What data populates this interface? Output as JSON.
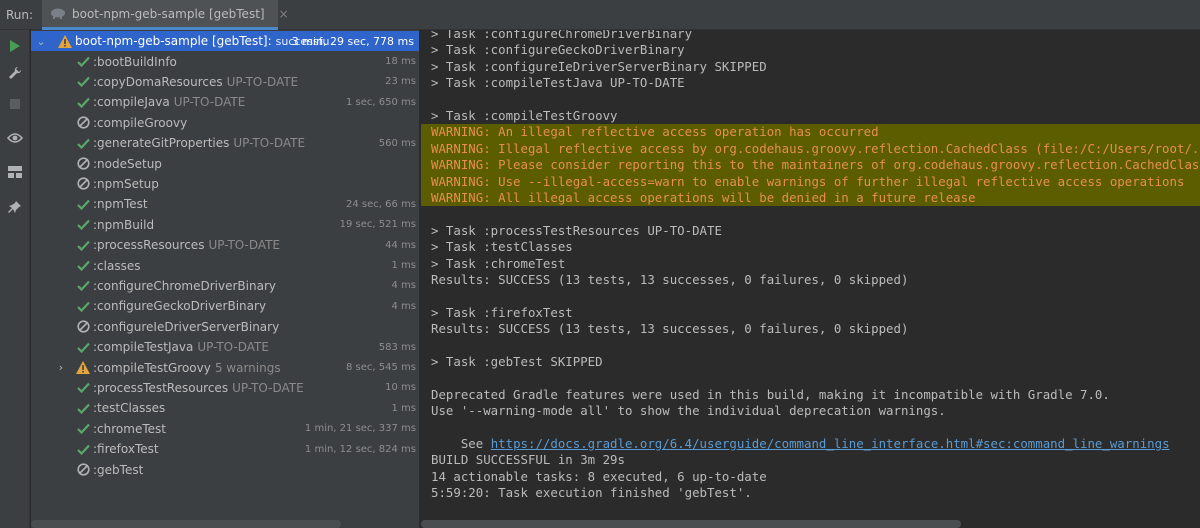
{
  "header": {
    "run_label": "Run:",
    "tab_title": "boot-npm-geb-sample [gebTest]",
    "tab_close": "×",
    "ghost_tab": "..."
  },
  "toolbar": {
    "buttons": [
      "run-icon",
      "wrench-icon",
      "stop-icon",
      "eye-icon",
      "layout-icon",
      "pin-icon"
    ]
  },
  "tree": {
    "root": {
      "name": "boot-npm-geb-sample [gebTest]:",
      "status": "successfu",
      "duration": "3 min, 29 sec, 778 ms"
    },
    "tasks": [
      {
        "name": ":bootBuildInfo",
        "status": "",
        "duration": "18 ms",
        "icon": "check-icon"
      },
      {
        "name": ":copyDomaResources",
        "status": "UP-TO-DATE",
        "duration": "23 ms",
        "icon": "check-icon"
      },
      {
        "name": ":compileJava",
        "status": "UP-TO-DATE",
        "duration": "1 sec, 650 ms",
        "icon": "check-icon"
      },
      {
        "name": ":compileGroovy",
        "status": "",
        "duration": "",
        "icon": "skipped-icon"
      },
      {
        "name": ":generateGitProperties",
        "status": "UP-TO-DATE",
        "duration": "560 ms",
        "icon": "check-icon"
      },
      {
        "name": ":nodeSetup",
        "status": "",
        "duration": "",
        "icon": "skipped-icon"
      },
      {
        "name": ":npmSetup",
        "status": "",
        "duration": "",
        "icon": "skipped-icon"
      },
      {
        "name": ":npmTest",
        "status": "",
        "duration": "24 sec, 66 ms",
        "icon": "check-icon"
      },
      {
        "name": ":npmBuild",
        "status": "",
        "duration": "19 sec, 521 ms",
        "icon": "check-icon"
      },
      {
        "name": ":processResources",
        "status": "UP-TO-DATE",
        "duration": "44 ms",
        "icon": "check-icon"
      },
      {
        "name": ":classes",
        "status": "",
        "duration": "1 ms",
        "icon": "check-icon"
      },
      {
        "name": ":configureChromeDriverBinary",
        "status": "",
        "duration": "4 ms",
        "icon": "check-icon"
      },
      {
        "name": ":configureGeckoDriverBinary",
        "status": "",
        "duration": "4 ms",
        "icon": "check-icon"
      },
      {
        "name": ":configureIeDriverServerBinary",
        "status": "",
        "duration": "",
        "icon": "skipped-icon"
      },
      {
        "name": ":compileTestJava",
        "status": "UP-TO-DATE",
        "duration": "583 ms",
        "icon": "check-icon"
      },
      {
        "name": ":compileTestGroovy",
        "status": "5 warnings",
        "duration": "8 sec, 545 ms",
        "icon": "warning-icon"
      },
      {
        "name": ":processTestResources",
        "status": "UP-TO-DATE",
        "duration": "10 ms",
        "icon": "check-icon"
      },
      {
        "name": ":testClasses",
        "status": "",
        "duration": "1 ms",
        "icon": "check-icon"
      },
      {
        "name": ":chromeTest",
        "status": "",
        "duration": "1 min, 21 sec, 337 ms",
        "icon": "check-icon"
      },
      {
        "name": ":firefoxTest",
        "status": "",
        "duration": "1 min, 12 sec, 824 ms",
        "icon": "check-icon"
      },
      {
        "name": ":gebTest",
        "status": "",
        "duration": "",
        "icon": "skipped-icon"
      }
    ]
  },
  "console": {
    "lines": [
      "> Task :configureChromeDriverBinary",
      "> Task :configureGeckoDriverBinary",
      "> Task :configureIeDriverServerBinary SKIPPED",
      "> Task :compileTestJava UP-TO-DATE",
      "",
      "> Task :compileTestGroovy",
      "WARNING: An illegal reflective access operation has occurred",
      "WARNING: Illegal reflective access by org.codehaus.groovy.reflection.CachedClass (file:/C:/Users/root/.g",
      "WARNING: Please consider reporting this to the maintainers of org.codehaus.groovy.reflection.CachedClass",
      "WARNING: Use --illegal-access=warn to enable warnings of further illegal reflective access operations",
      "WARNING: All illegal access operations will be denied in a future release",
      "",
      "> Task :processTestResources UP-TO-DATE",
      "> Task :testClasses",
      "> Task :chromeTest",
      "Results: SUCCESS (13 tests, 13 successes, 0 failures, 0 skipped)",
      "",
      "> Task :firefoxTest",
      "Results: SUCCESS (13 tests, 13 successes, 0 failures, 0 skipped)",
      "",
      "> Task :gebTest SKIPPED",
      "",
      "Deprecated Gradle features were used in this build, making it incompatible with Gradle 7.0.",
      "Use '--warning-mode all' to show the individual deprecation warnings.",
      "",
      "",
      "BUILD SUCCESSFUL in 3m 29s",
      "14 actionable tasks: 8 executed, 6 up-to-date",
      "5:59:20: Task execution finished 'gebTest'."
    ],
    "see_prefix": "See ",
    "docs_link": "https://docs.gradle.org/6.4/userguide/command_line_interface.html#sec:command_line_warnings"
  },
  "colors": {
    "accent": "#2f65ca",
    "success": "#59a869",
    "warning": "#e5a53c",
    "warning_text": "#e58f4f",
    "warning_bg": "#5c5c00"
  }
}
